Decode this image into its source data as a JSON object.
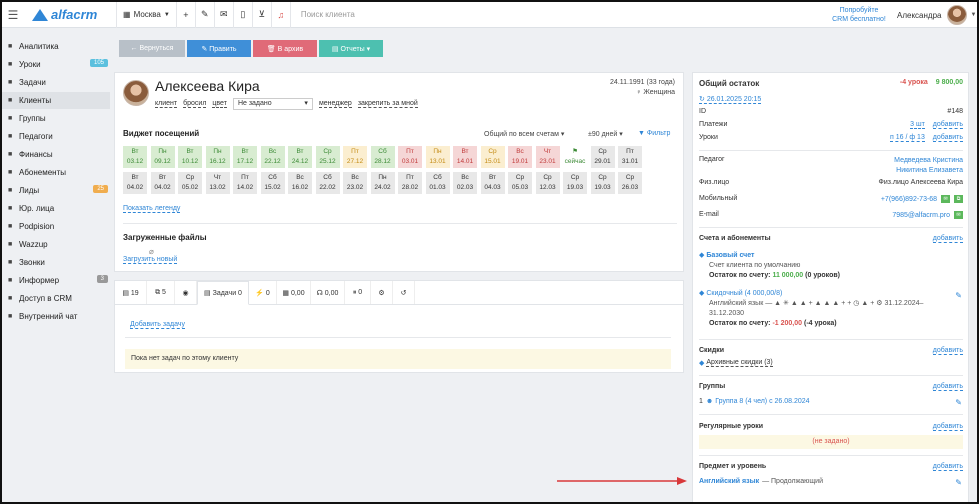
{
  "topbar": {
    "logo_text": "alfacrm",
    "city": "Москва",
    "search_placeholder": "Поиск клиента",
    "trial_line1": "Попробуйте",
    "trial_line2": "CRM бесплатно!",
    "user_name": "Александра"
  },
  "sidebar": {
    "items": [
      {
        "label": "Аналитика",
        "icon": "chart-icon"
      },
      {
        "label": "Уроки",
        "icon": "calendar-icon",
        "badge": "105",
        "badge_color": "#5bc0de"
      },
      {
        "label": "Задачи",
        "icon": "tasks-icon"
      },
      {
        "label": "Клиенты",
        "icon": "user-icon"
      },
      {
        "label": "Группы",
        "icon": "group-icon"
      },
      {
        "label": "Педагоги",
        "icon": "teacher-icon"
      },
      {
        "label": "Финансы",
        "icon": "finance-icon"
      },
      {
        "label": "Абонементы",
        "icon": "tag-icon"
      },
      {
        "label": "Лиды",
        "icon": "leads-icon",
        "badge": "25",
        "badge_color": "#f0ad4e"
      },
      {
        "label": "Юр. лица",
        "icon": "building-icon"
      },
      {
        "label": "Podpision",
        "icon": "doc-icon"
      },
      {
        "label": "Wazzup",
        "icon": "chat-icon"
      },
      {
        "label": "Звонки",
        "icon": "phone-icon"
      },
      {
        "label": "Информер",
        "icon": "informer-icon",
        "badge": "3",
        "badge_color": "#999999"
      },
      {
        "label": "Доступ в CRM",
        "icon": "lock-icon"
      },
      {
        "label": "Внутренний чат",
        "icon": "inner-chat-icon"
      }
    ]
  },
  "actions": {
    "back": "← Вернуться",
    "edit": "✎ Править",
    "archive": "🗑 В архив",
    "reports": "▤ Отчеты ▾"
  },
  "client": {
    "name": "Алексеева Кира",
    "birth": "24.11.1991 (33 года)",
    "gender": "♀ Женщина",
    "tag_client": "клиент",
    "tag_dropped": "бросил",
    "tag_color": "цвет",
    "status_select": "Не задано",
    "manager_label": "менеджер",
    "assign_label": "закрепить за мной"
  },
  "visits": {
    "title": "Виджет посещений",
    "filter_accounts": "Общий по всем счетам ▾",
    "filter_days": "±90 дней ▾",
    "filter_button": "Фильтр",
    "show_legend": "Показать легенду",
    "row1": [
      {
        "d": "Вт",
        "n": "03.12",
        "s": "g"
      },
      {
        "d": "Пн",
        "n": "09.12",
        "s": "g"
      },
      {
        "d": "Вт",
        "n": "10.12",
        "s": "g"
      },
      {
        "d": "Пн",
        "n": "16.12",
        "s": "g"
      },
      {
        "d": "Вт",
        "n": "17.12",
        "s": "g"
      },
      {
        "d": "Вс",
        "n": "22.12",
        "s": "g"
      },
      {
        "d": "Вт",
        "n": "24.12",
        "s": "g"
      },
      {
        "d": "Ср",
        "n": "25.12",
        "s": "g"
      },
      {
        "d": "Пт",
        "n": "27.12",
        "s": "y"
      },
      {
        "d": "Сб",
        "n": "28.12",
        "s": "g"
      },
      {
        "d": "Пт",
        "n": "03.01",
        "s": "r"
      },
      {
        "d": "Пн",
        "n": "13.01",
        "s": "y"
      },
      {
        "d": "Вт",
        "n": "14.01",
        "s": "r"
      },
      {
        "d": "Ср",
        "n": "15.01",
        "s": "y"
      },
      {
        "d": "Вс",
        "n": "19.01",
        "s": "r"
      },
      {
        "d": "Чт",
        "n": "23.01",
        "s": "r"
      },
      {
        "d": "⚑",
        "n": "сейчас",
        "s": "now"
      },
      {
        "d": "Ср",
        "n": "29.01",
        "s": "f"
      },
      {
        "d": "Пт",
        "n": "31.01",
        "s": "f"
      }
    ],
    "row2": [
      {
        "d": "Вт",
        "n": "04.02",
        "s": "f"
      },
      {
        "d": "Вт",
        "n": "04.02",
        "s": "f"
      },
      {
        "d": "Ср",
        "n": "05.02",
        "s": "f"
      },
      {
        "d": "Чт",
        "n": "13.02",
        "s": "f"
      },
      {
        "d": "Пт",
        "n": "14.02",
        "s": "f"
      },
      {
        "d": "Сб",
        "n": "15.02",
        "s": "f"
      },
      {
        "d": "Вс",
        "n": "16.02",
        "s": "f"
      },
      {
        "d": "Сб",
        "n": "22.02",
        "s": "f"
      },
      {
        "d": "Вс",
        "n": "23.02",
        "s": "f"
      },
      {
        "d": "Пн",
        "n": "24.02",
        "s": "f"
      },
      {
        "d": "Пт",
        "n": "28.02",
        "s": "f"
      },
      {
        "d": "Сб",
        "n": "01.03",
        "s": "f"
      },
      {
        "d": "Вс",
        "n": "02.03",
        "s": "f"
      },
      {
        "d": "Вт",
        "n": "04.03",
        "s": "f"
      },
      {
        "d": "Ср",
        "n": "05.03",
        "s": "f"
      },
      {
        "d": "Ср",
        "n": "12.03",
        "s": "f"
      },
      {
        "d": "Ср",
        "n": "19.03",
        "s": "f"
      },
      {
        "d": "Ср",
        "n": "19.03",
        "s": "f"
      },
      {
        "d": "Ср",
        "n": "26.03",
        "s": "f"
      }
    ]
  },
  "files": {
    "title": "Загруженные файлы",
    "upload": "Загрузить новый"
  },
  "tabs": [
    {
      "label": "▤ 19",
      "icon": "list-icon"
    },
    {
      "label": "⧉ 5",
      "icon": "copy-icon"
    },
    {
      "label": "◉",
      "icon": "whatsapp-icon"
    },
    {
      "label": "▤ Задачи 0",
      "icon": "tasks-icon"
    },
    {
      "label": "⚡ 0",
      "icon": "bolt-icon"
    },
    {
      "label": "▦ 0,00",
      "icon": "money-icon"
    },
    {
      "label": "☊ 0,00",
      "icon": "headset-icon"
    },
    {
      "label": "⏸ 0",
      "icon": "pause-icon"
    },
    {
      "label": "⚙",
      "icon": "gear-icon"
    },
    {
      "label": "↺",
      "icon": "history-icon"
    }
  ],
  "tasks": {
    "add": "Добавить задачу",
    "empty": "Пока нет задач по этому клиенту"
  },
  "right": {
    "balance_title": "Общий остаток",
    "balance_lessons": "-4 урока",
    "balance_money": "9 800,00",
    "date_link": "26.01.2025 20:15",
    "id_label": "ID",
    "id_value": "#148",
    "payments_label": "Платежи",
    "payments_value": "3 шт",
    "payments_add": "добавить",
    "lessons_label": "Уроки",
    "lessons_value": "п 16 / ф 13",
    "lessons_add": "добавить",
    "teacher_label": "Педагог",
    "teacher_1": "Медведева Кристина",
    "teacher_2": "Никитина Елизавета",
    "person_label": "Физ.лицо",
    "person_value": "Физ.лицо Алексеева Кира",
    "mobile_label": "Мобильный",
    "mobile_value": "+7(966)892-73-68",
    "email_label": "E-mail",
    "email_value": "7985@alfacrm.pro",
    "accounts_title": "Счета и абонементы",
    "accounts_add": "добавить",
    "base_title": "Базовый счет",
    "base_sub": "Счет клиента по умолчанию",
    "base_balance_label": "Остаток по счету:",
    "base_balance_money": "11 000,00",
    "base_balance_lessons": "(0 уроков)",
    "discount_title": "Скидочный (4 000,00/8)",
    "discount_sub": "Английский язык — ▲ ✳ ▲ ▲ + ▲ ▲ ▲ + + ◷ ▲ + ⚙  31.12.2024–31.12.2030",
    "discount_balance_label": "Остаток по счету:",
    "discount_balance_money": "-1 200,00",
    "discount_balance_lessons": "(-4 урока)",
    "discounts_title": "Скидки",
    "discounts_add": "добавить",
    "discounts_archive": "Архивные скидки (3)",
    "groups_title": "Группы",
    "groups_add": "добавить",
    "groups_value": "Группа 8 (4 чел) с 26.08.2024",
    "groups_count": "1",
    "regular_title": "Регулярные уроки",
    "regular_add": "добавить",
    "regular_empty": "(не задано)",
    "subject_title": "Предмет и уровень",
    "subject_add": "добавить",
    "subject_value": "Английский язык",
    "subject_level": "— Продолжающий"
  },
  "colors": {
    "accent": "#2f86d6",
    "back": "#b8c0c8",
    "edit": "#3f8fd8",
    "archive": "#e06a78",
    "reports": "#4dc0b0"
  }
}
